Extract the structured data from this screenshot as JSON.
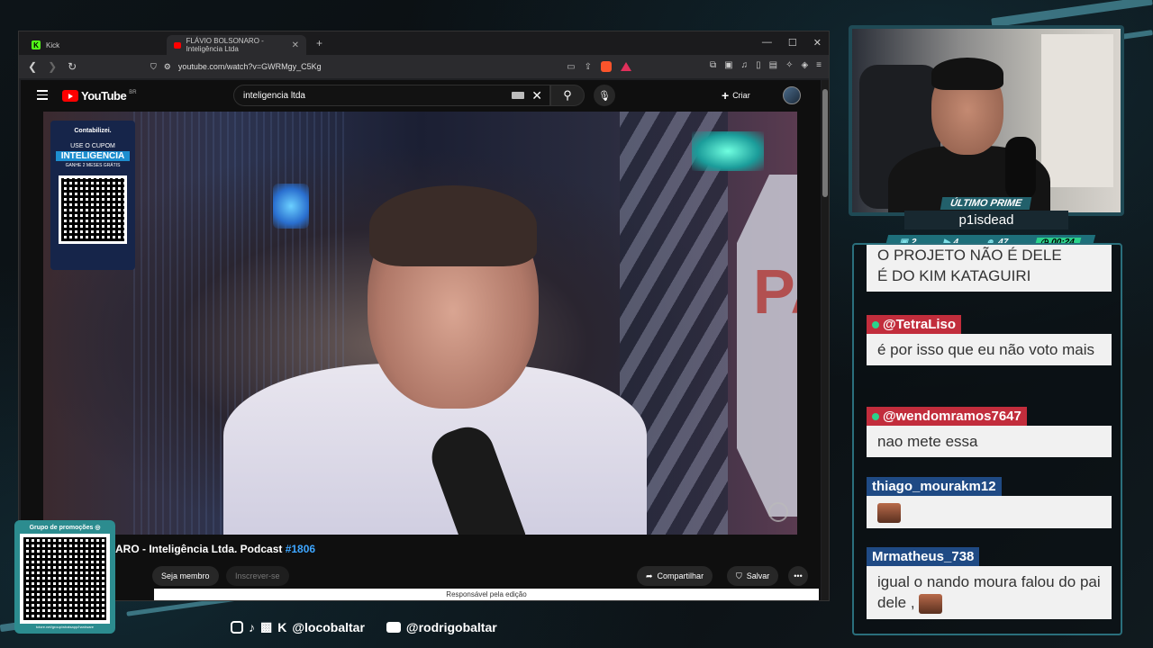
{
  "browser": {
    "tabs": [
      {
        "label": "Kick",
        "icon": "kick-icon"
      },
      {
        "label": "FLÁVIO BOLSONARO - Inteligência Ltda",
        "icon": "youtube-icon",
        "active": true
      }
    ],
    "url": "youtube.com/watch?v=GWRMgy_C5Kg"
  },
  "youtube": {
    "logo_text": "YouTube",
    "region": "BR",
    "search_value": "inteligencia ltda",
    "create_label": "Criar",
    "video_title_main": "ARO - Inteligência Ltda. Podcast ",
    "video_title_tag": "#1806",
    "member_label": "Seja membro",
    "subscribe_label": "Inscrever-se",
    "share_label": "Compartilhar",
    "save_label": "Salvar",
    "edit_credit": "Responsável pela edição",
    "promo": {
      "brand": "Contabilizei.",
      "line1": "USE O CUPOM",
      "line2": "INTELIGENCIA",
      "line3": "GANHE 2 MESES GRÁTIS"
    },
    "stop_sign_text": "PA"
  },
  "stream": {
    "badge": "ÚLTIMO PRIME",
    "streamer": "p1isdead",
    "stats": {
      "chat": "2",
      "video": "4",
      "viewers": "47",
      "time": "00:24"
    }
  },
  "chat": {
    "messages": [
      {
        "user": "",
        "text": "O PROJETO NÃO É DELE\nÉ DO KIM KATAGUIRI"
      },
      {
        "user": "@TetraLiso",
        "text": "é por isso que eu não voto mais"
      },
      {
        "user": "@wendomramos7647",
        "text": "nao mete essa"
      },
      {
        "user": "thiago_mourakm12",
        "text": ""
      },
      {
        "user": "Mrmatheus_738",
        "text": "igual o nando moura falou do pai dele ,"
      }
    ]
  },
  "overlay": {
    "qr_label": "Grupo de promoções",
    "qr_url": "tctore.net/group/whatsapp/hardware",
    "social_kick": "@locobaltar",
    "social_youtube": "@rodrigobaltar"
  },
  "colors": {
    "accent": "#2a6f7c",
    "red_user": "#c22d3c",
    "blue_user": "#1f4a84",
    "link": "#3ea6ff"
  }
}
